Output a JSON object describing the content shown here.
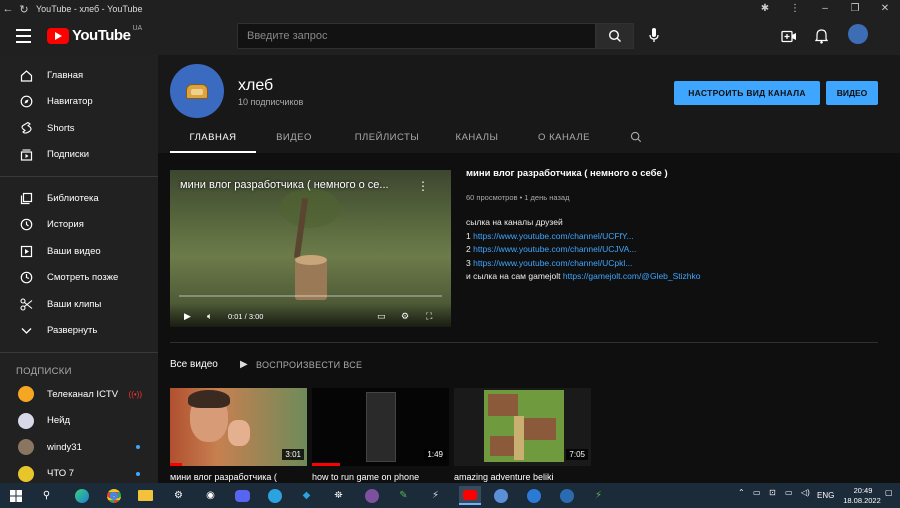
{
  "window": {
    "title": "YouTube - хлеб - YouTube",
    "minimize": "–",
    "maximize": "❐",
    "close": "✕",
    "ext": "✱",
    "more": "⋮"
  },
  "header": {
    "search_placeholder": "Введите запрос",
    "logo_text": "YouTube",
    "country": "UA"
  },
  "sidebar": {
    "main": [
      {
        "label": "Главная",
        "icon": "home-icon"
      },
      {
        "label": "Навигатор",
        "icon": "compass-icon"
      },
      {
        "label": "Shorts",
        "icon": "shorts-icon"
      },
      {
        "label": "Подписки",
        "icon": "subscriptions-icon"
      }
    ],
    "library": [
      {
        "label": "Библиотека",
        "icon": "library-icon"
      },
      {
        "label": "История",
        "icon": "history-icon"
      },
      {
        "label": "Ваши видео",
        "icon": "your-videos-icon"
      },
      {
        "label": "Смотреть позже",
        "icon": "watch-later-icon"
      },
      {
        "label": "Ваши клипы",
        "icon": "clips-icon"
      },
      {
        "label": "Развернуть",
        "icon": "chevron-down-icon"
      }
    ],
    "subs_title": "ПОДПИСКИ",
    "subs": [
      {
        "label": "Телеканал ICTV",
        "badge": "live",
        "color": "#f5a623"
      },
      {
        "label": "Нейд",
        "badge": "",
        "color": "#d8d8e8"
      },
      {
        "label": "windy31",
        "badge": "dot",
        "color": "#8a7560"
      },
      {
        "label": "ЧТО 7",
        "badge": "dot",
        "color": "#e8c52a"
      }
    ]
  },
  "channel": {
    "name": "хлеб",
    "subscribers": "10 подписчиков",
    "customize_btn": "НАСТРОИТЬ ВИД КАНАЛА",
    "video_btn": "ВИДЕО",
    "tabs": [
      "ГЛАВНАЯ",
      "ВИДЕО",
      "ПЛЕЙЛИСТЫ",
      "КАНАЛЫ",
      "О КАНАЛЕ"
    ]
  },
  "featured": {
    "player_title": "мини влог разработчика ( немного о се...",
    "time": "0:01 / 3:00",
    "title": "мини влог разработчика ( немного о себе )",
    "meta": "60 просмотров • 1 день назад",
    "desc_lines": [
      {
        "text": "сылка на каналы друзей",
        "link": ""
      },
      {
        "text": "1 ",
        "link": "https://www.youtube.com/channel/UCFfY..."
      },
      {
        "text": "2 ",
        "link": "https://www.youtube.com/channel/UCJVA..."
      },
      {
        "text": "3 ",
        "link": "https://www.youtube.com/channel/UCpkl..."
      },
      {
        "text": "и сылка на сам gamejolt ",
        "link": "https://gamejolt.com/@Gleb_Stizhko"
      }
    ]
  },
  "videos": {
    "heading": "Все видео",
    "play_all": "ВОСПРОИЗВЕСТИ ВСЕ",
    "items": [
      {
        "title": "мини влог разработчика (",
        "duration": "3:01",
        "progress": 0.1
      },
      {
        "title": "how to run game on phone",
        "duration": "1:49",
        "progress": 0.2
      },
      {
        "title": "amazing adventure beliki",
        "duration": "7:05",
        "progress": 0.0
      }
    ]
  },
  "taskbar": {
    "lang": "ENG",
    "time": "20:49",
    "date": "18.08.2022"
  }
}
